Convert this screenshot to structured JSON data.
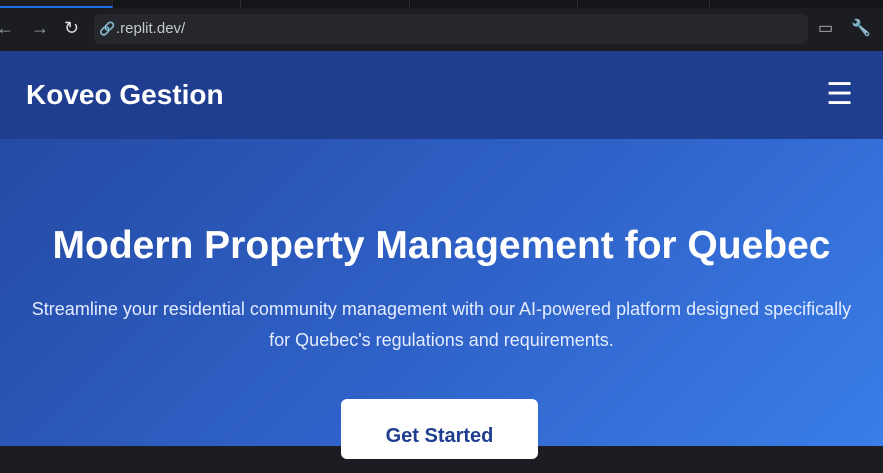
{
  "browser": {
    "url": ".replit.dev/"
  },
  "header": {
    "brand": "Koveo Gestion",
    "menu_icon": "☰"
  },
  "hero": {
    "title": "Modern Property Management for Quebec",
    "subtitle": "Streamline your residential community management with our AI-powered platform designed specifically for Quebec's regulations and requirements.",
    "cta": "Get Started"
  }
}
